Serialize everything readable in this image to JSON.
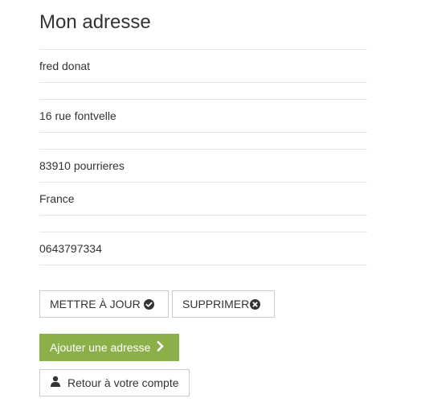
{
  "page": {
    "title": "Mon adresse"
  },
  "address": {
    "name": "fred donat",
    "company": "",
    "street": "16 rue fontvelle",
    "street2": "",
    "city_line": "83910 pourrieres",
    "country": "France",
    "phone_home": "",
    "phone": "0643797334"
  },
  "actions": {
    "update_label": "METTRE À JOUR",
    "delete_label": "SUPPRIMER",
    "add_label": "Ajouter une adresse",
    "back_label": "Retour à votre compte"
  },
  "icons": {
    "update": "check-circle-icon",
    "delete": "remove-circle-icon",
    "add": "chevron-right-icon",
    "back": "user-icon"
  },
  "colors": {
    "accent": "#8cb049",
    "text": "#333333",
    "border": "#cccccc",
    "divider": "#e5e5e5"
  }
}
